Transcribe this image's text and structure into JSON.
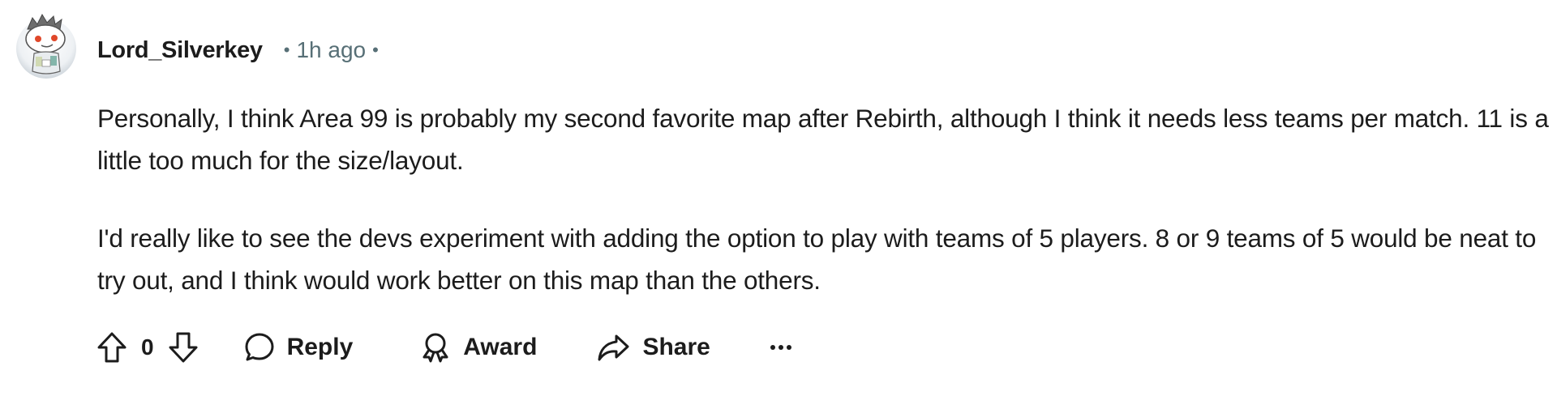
{
  "comment": {
    "author": "Lord_Silverkey",
    "separator": "•",
    "timestamp": "1h ago",
    "avatar": {
      "icon": "snoo-avatar-icon",
      "accent_color": "#e8542a"
    },
    "paragraphs": [
      "Personally, I think Area 99 is probably my second favorite map after Rebirth, although I think it needs less teams per match. 11 is a little too much for the size/layout.",
      "I'd really like to see the devs experiment with adding the option to play with teams of 5 players. 8 or 9 teams of 5 would be neat to try out, and I think would work better on this map than the others."
    ]
  },
  "actions": {
    "upvote_icon": "upvote-arrow-icon",
    "vote_count": "0",
    "downvote_icon": "downvote-arrow-icon",
    "reply_label": "Reply",
    "reply_icon": "speech-bubble-icon",
    "award_label": "Award",
    "award_icon": "award-ribbon-icon",
    "share_label": "Share",
    "share_icon": "share-arrow-icon",
    "more_label": "···",
    "more_icon": "overflow-menu-icon"
  },
  "colors": {
    "text_primary": "#1c1c1c",
    "text_meta": "#576f76",
    "background": "#ffffff"
  }
}
